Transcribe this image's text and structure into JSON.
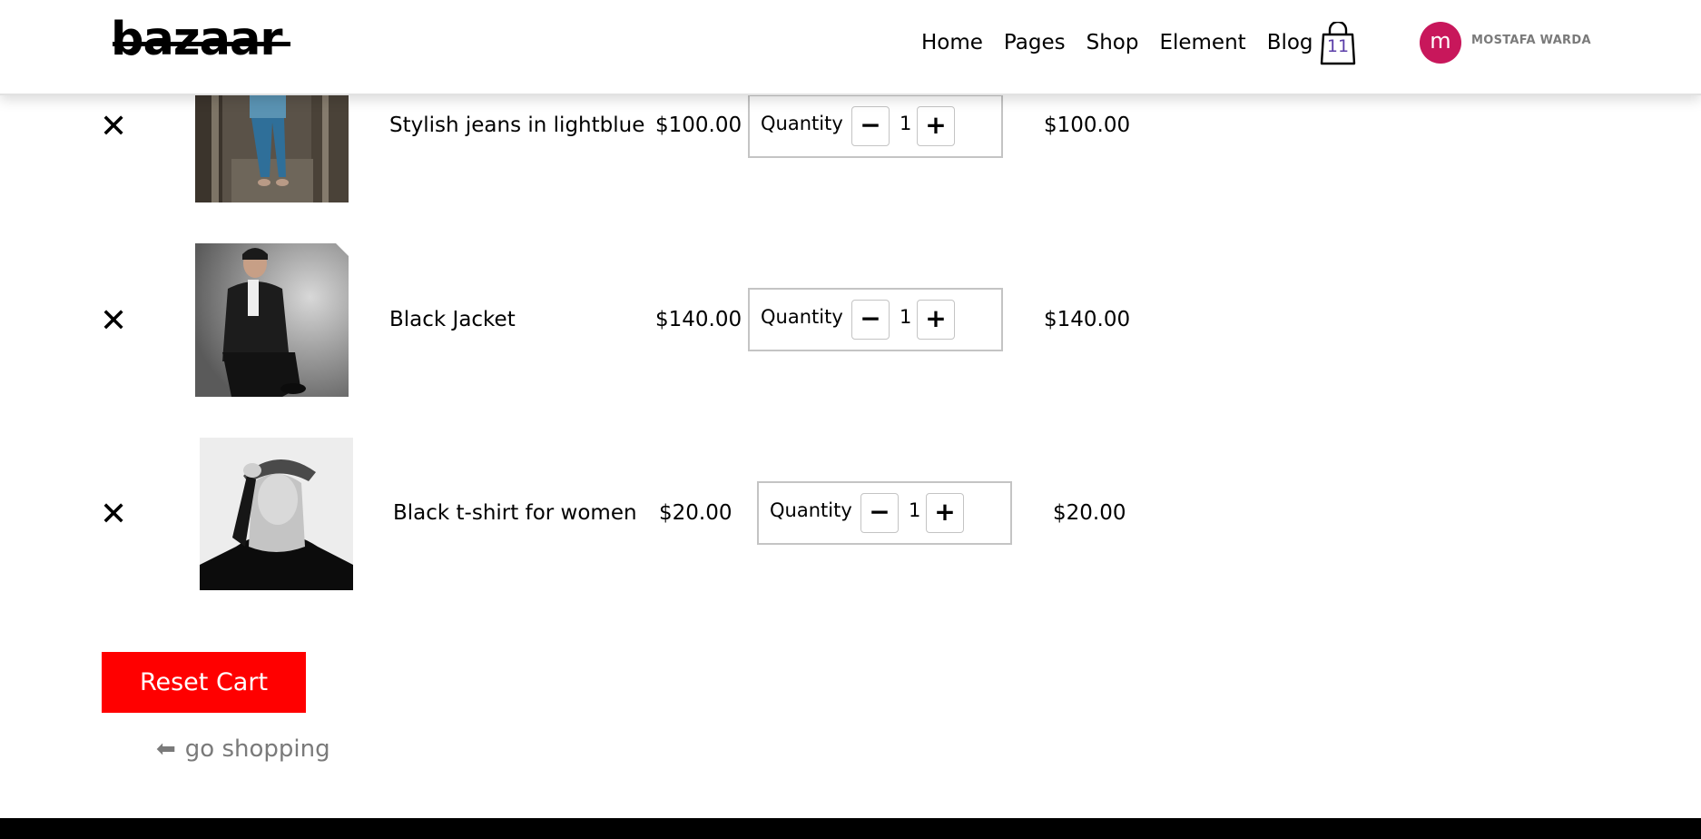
{
  "header": {
    "logo": "bazaar",
    "nav": [
      "Home",
      "Pages",
      "Shop",
      "Element",
      "Blog"
    ],
    "cart_count": "11",
    "avatar_letter": "m",
    "username": "MOSTAFA WARDA"
  },
  "cart": {
    "quantity_label": "Quantity",
    "remove_symbol": "✕",
    "minus_symbol": "−",
    "plus_symbol": "+",
    "items": [
      {
        "name": "Stylish jeans in lightblue",
        "price": "$100.00",
        "qty": "1",
        "total": "$100.00"
      },
      {
        "name": "Black Jacket",
        "price": "$140.00",
        "qty": "1",
        "total": "$140.00"
      },
      {
        "name": "Black t-shirt for women",
        "price": "$20.00",
        "qty": "1",
        "total": "$20.00"
      }
    ]
  },
  "actions": {
    "reset_label": "Reset Cart",
    "go_shopping_arrow": "⬅",
    "go_shopping_label": "go shopping"
  },
  "colors": {
    "reset": "#ff0000",
    "avatar": "#c8175b",
    "cart_count": "#5b3ea8",
    "muted_text": "#7a7a7a"
  }
}
